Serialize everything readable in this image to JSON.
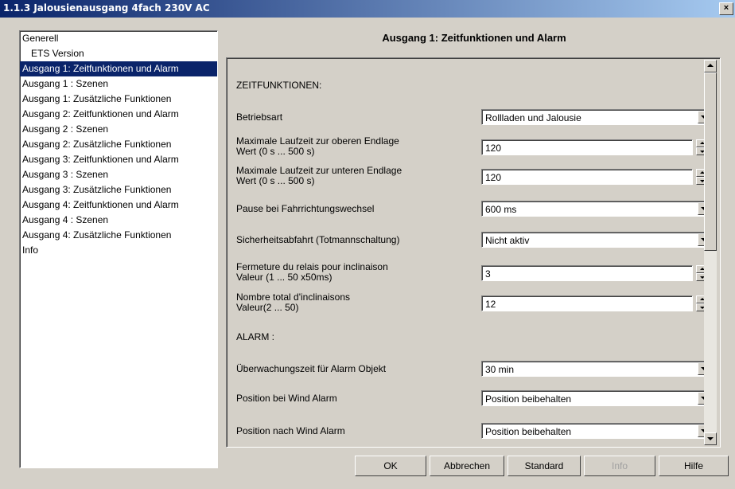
{
  "window": {
    "title": "1.1.3 Jalousienausgang 4fach 230V AC",
    "close_label": "×"
  },
  "tree": {
    "items": [
      {
        "label": "Generell"
      },
      {
        "label": "ETS Version"
      },
      {
        "label": "Ausgang 1: Zeitfunktionen und Alarm"
      },
      {
        "label": "Ausgang 1 : Szenen"
      },
      {
        "label": "Ausgang 1: Zusätzliche Funktionen"
      },
      {
        "label": "Ausgang 2: Zeitfunktionen und Alarm"
      },
      {
        "label": "Ausgang 2 : Szenen"
      },
      {
        "label": "Ausgang 2: Zusätzliche Funktionen"
      },
      {
        "label": "Ausgang 3: Zeitfunktionen und Alarm"
      },
      {
        "label": "Ausgang 3 : Szenen"
      },
      {
        "label": "Ausgang 3: Zusätzliche Funktionen"
      },
      {
        "label": "Ausgang 4: Zeitfunktionen und Alarm"
      },
      {
        "label": "Ausgang 4 : Szenen"
      },
      {
        "label": "Ausgang 4: Zusätzliche Funktionen"
      },
      {
        "label": "Info"
      }
    ],
    "selected_index": 2
  },
  "main": {
    "heading": "Ausgang 1: Zeitfunktionen und Alarm",
    "section_time": "ZEITFUNKTIONEN:",
    "section_alarm": "ALARM :",
    "params": [
      {
        "label1": "Betriebsart",
        "label2": "",
        "value": "Rollladen und Jalousie",
        "kind": "combo"
      },
      {
        "label1": "Maximale Laufzeit zur oberen Endlage",
        "label2": "Wert (0 s ... 500 s)",
        "value": "120",
        "kind": "spin"
      },
      {
        "label1": "Maximale Laufzeit zur unteren Endlage",
        "label2": "Wert (0 s ... 500 s)",
        "value": "120",
        "kind": "spin"
      },
      {
        "label1": "Pause bei Fahrrichtungswechsel",
        "label2": "",
        "value": "600 ms",
        "kind": "combo"
      },
      {
        "label1": "Sicherheitsabfahrt (Totmannschaltung)",
        "label2": "",
        "value": "Nicht aktiv",
        "kind": "combo"
      },
      {
        "label1": "Fermeture du relais pour inclinaison",
        "label2": "Valeur (1 ... 50 x50ms)",
        "value": "3",
        "kind": "spin"
      },
      {
        "label1": "Nombre total d'inclinaisons",
        "label2": "Valeur(2 ... 50)",
        "value": "12",
        "kind": "spin"
      },
      {
        "label1": "Überwachungszeit für Alarm Objekt",
        "label2": "",
        "value": "30 min",
        "kind": "combo"
      },
      {
        "label1": "Position bei Wind Alarm",
        "label2": "",
        "value": "Position beibehalten",
        "kind": "combo"
      },
      {
        "label1": "Position nach Wind Alarm",
        "label2": "",
        "value": "Position beibehalten",
        "kind": "combo"
      }
    ]
  },
  "buttons": {
    "ok": "OK",
    "cancel": "Abbrechen",
    "standard": "Standard",
    "info": "Info",
    "help": "Hilfe"
  }
}
